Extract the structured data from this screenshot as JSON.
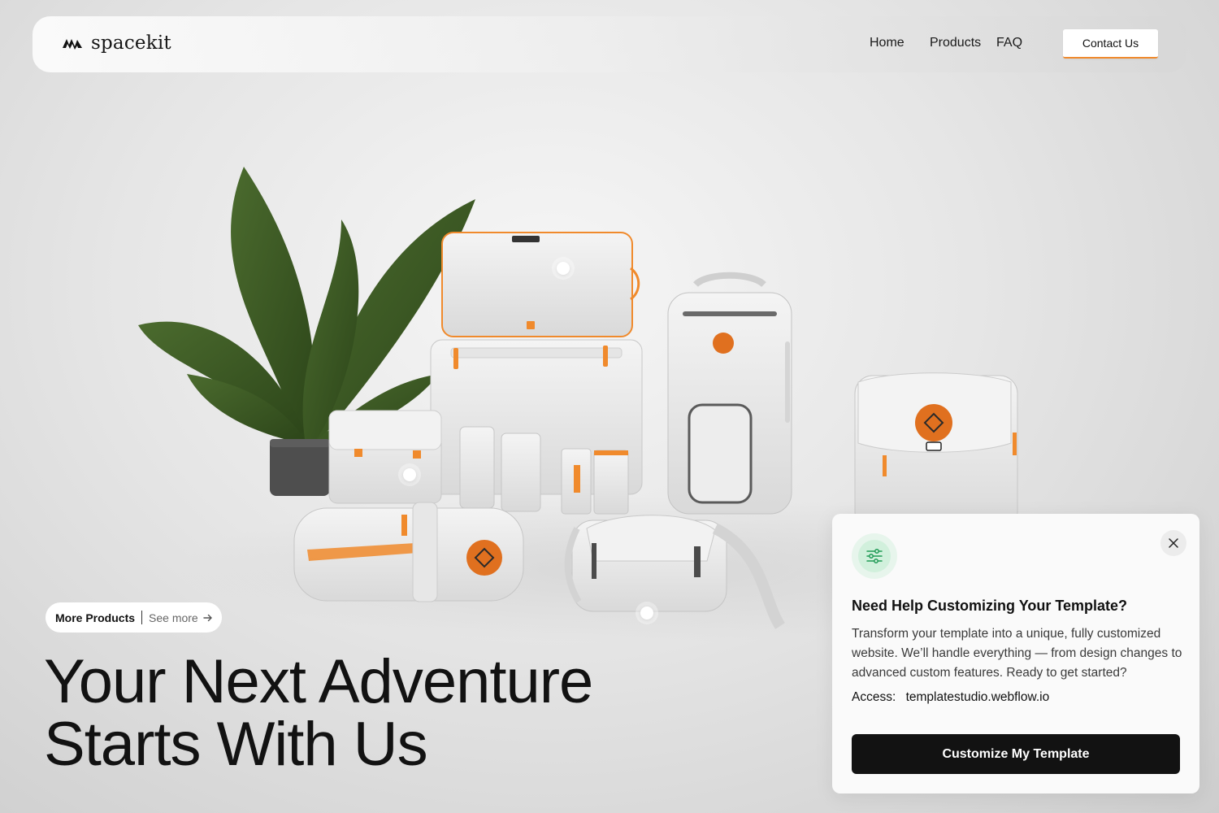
{
  "brand": {
    "name": "spacekit",
    "logo_icon": "spacekit-logo-icon"
  },
  "nav": {
    "items": [
      {
        "label": "Home"
      },
      {
        "label": "Products"
      },
      {
        "label": "FAQ"
      }
    ],
    "contact_label": "Contact Us"
  },
  "hero": {
    "image_icon": "product-lineup-image",
    "headline_line1": "Your Next Adventure",
    "headline_line2": "Starts With Us",
    "pill": {
      "label": "More Products",
      "link_label": "See more",
      "link_icon": "arrow-right-icon"
    }
  },
  "popup": {
    "icon": "sliders-icon",
    "title": "Need Help Customizing Your Template?",
    "body": "Transform your template into a unique, fully customized website. We’ll handle everything — from design changes to advanced custom features. Ready to get started?",
    "access_label": "Access:",
    "access_value": "templatestudio.webflow.io",
    "cta_label": "Customize My Template",
    "close_icon": "close-icon"
  },
  "colors": {
    "accent": "#f08a2c",
    "dark": "#121212",
    "popup_icon_bg": "#d1f0dc",
    "popup_icon_stroke": "#1f9a55"
  }
}
